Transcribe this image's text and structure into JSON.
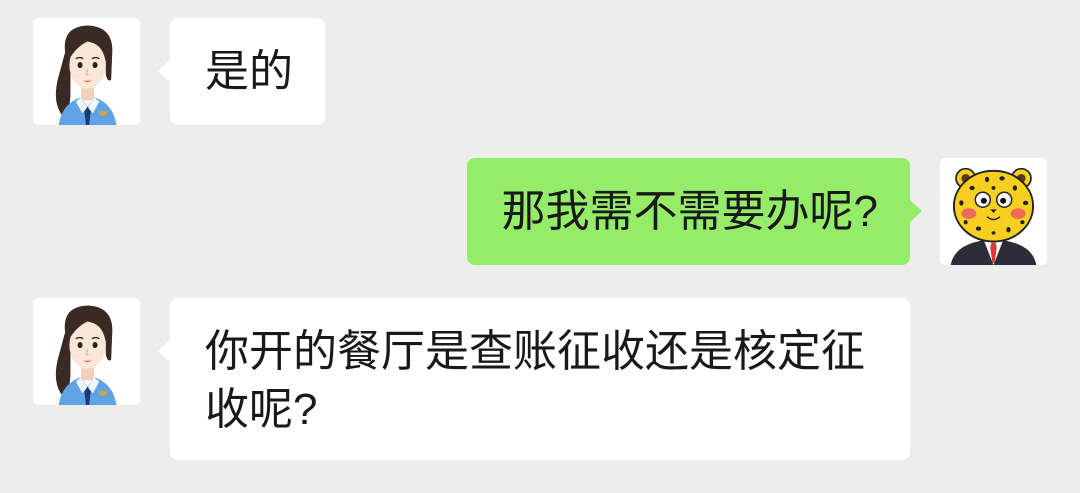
{
  "chat": {
    "messages": [
      {
        "side": "left",
        "sender": "officer",
        "text": "是的"
      },
      {
        "side": "right",
        "sender": "user",
        "text": "那我需不需要办呢?"
      },
      {
        "side": "left",
        "sender": "officer",
        "text": "你开的餐厅是查账征收还是核定征收呢?"
      }
    ]
  },
  "avatars": {
    "officer": "officer-avatar-icon",
    "user": "leopard-avatar-icon"
  },
  "colors": {
    "background": "#ededed",
    "incoming_bubble": "#ffffff",
    "outgoing_bubble": "#95ec69",
    "text": "#191919"
  }
}
